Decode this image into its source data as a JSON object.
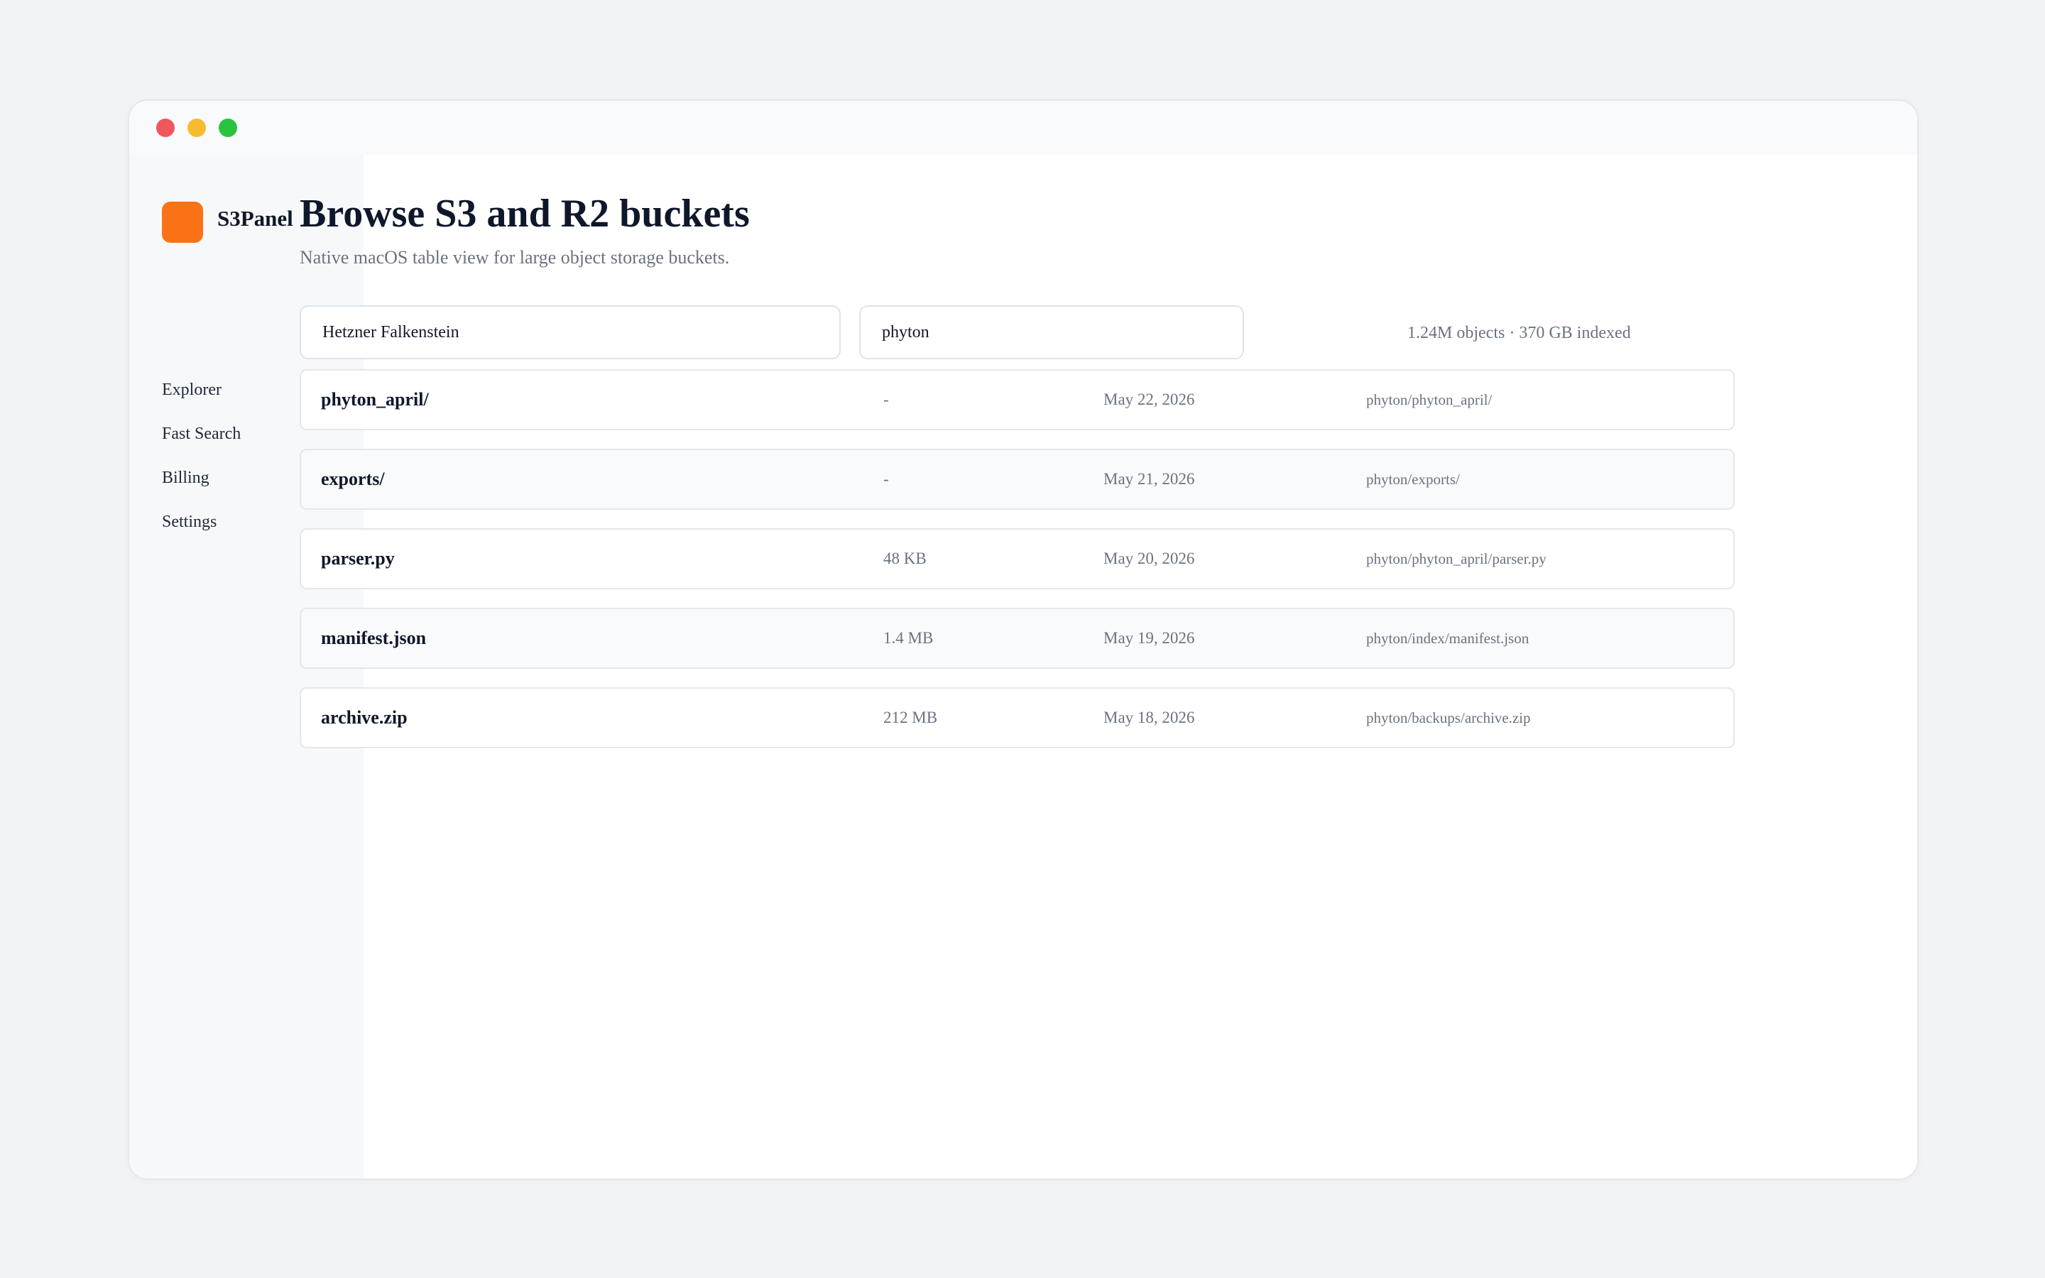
{
  "app": {
    "name": "S3Panel",
    "accent_color": "#f97316"
  },
  "window_controls": [
    "close",
    "minimize",
    "zoom"
  ],
  "sidebar": {
    "items": [
      {
        "label": "Explorer"
      },
      {
        "label": "Fast Search"
      },
      {
        "label": "Billing"
      },
      {
        "label": "Settings"
      }
    ]
  },
  "header": {
    "title": "Browse S3 and R2 buckets",
    "subtitle": "Native macOS table view for large object storage buckets."
  },
  "toolbar": {
    "provider_value": "Hetzner Falkenstein",
    "search_value": "phyton",
    "stats": "1.24M objects · 370 GB indexed"
  },
  "objects": [
    {
      "name": "phyton_april/",
      "size": "-",
      "modified": "May 22, 2026",
      "path": "phyton/phyton_april/"
    },
    {
      "name": "exports/",
      "size": "-",
      "modified": "May 21, 2026",
      "path": "phyton/exports/"
    },
    {
      "name": "parser.py",
      "size": "48 KB",
      "modified": "May 20, 2026",
      "path": "phyton/phyton_april/parser.py"
    },
    {
      "name": "manifest.json",
      "size": "1.4 MB",
      "modified": "May 19, 2026",
      "path": "phyton/index/manifest.json"
    },
    {
      "name": "archive.zip",
      "size": "212 MB",
      "modified": "May 18, 2026",
      "path": "phyton/backups/archive.zip"
    }
  ]
}
